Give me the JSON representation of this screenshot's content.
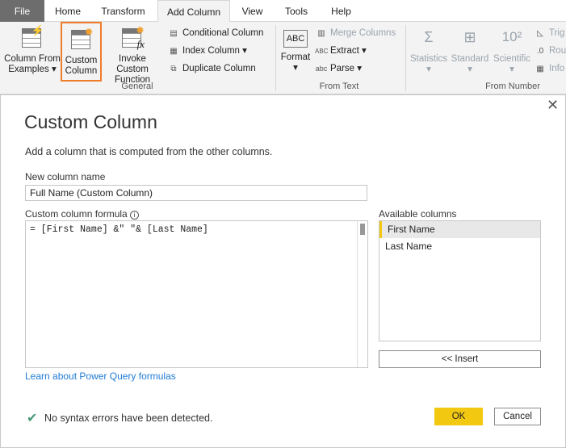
{
  "tabs": [
    "File",
    "Home",
    "Transform",
    "Add Column",
    "View",
    "Tools",
    "Help"
  ],
  "active_tab": "Add Column",
  "ribbon": {
    "general": {
      "label": "General",
      "column_from_examples": [
        "Column From",
        "Examples"
      ],
      "custom_column": [
        "Custom",
        "Column"
      ],
      "invoke_custom_function": [
        "Invoke Custom",
        "Function"
      ],
      "conditional_column": "Conditional Column",
      "index_column": "Index Column",
      "duplicate_column": "Duplicate Column"
    },
    "from_text": {
      "label": "From Text",
      "format": "Format",
      "merge_columns": "Merge Columns",
      "extract": "Extract",
      "parse": "Parse"
    },
    "from_number": {
      "label": "From Number",
      "statistics": "Statistics",
      "standard": "Standard",
      "scientific": "Scientific",
      "trig": "Trig",
      "rounding": "Rou",
      "info": "Info"
    },
    "highlight_color": "#f07c2a"
  },
  "dialog": {
    "title": "Custom Column",
    "subtitle": "Add a column that is computed from the other columns.",
    "name_label": "New column name",
    "name_value": "Full Name (Custom Column)",
    "formula_label": "Custom column formula",
    "formula_value": "= [First Name] &\" \"& [Last Name]",
    "available_label": "Available columns",
    "available_columns": [
      "First Name",
      "Last Name"
    ],
    "selected_column": "First Name",
    "insert_label": "<< Insert",
    "learn_link": "Learn about Power Query formulas",
    "status": "No syntax errors have been detected.",
    "ok_label": "OK",
    "cancel_label": "Cancel",
    "ok_color": "#f2c811"
  }
}
